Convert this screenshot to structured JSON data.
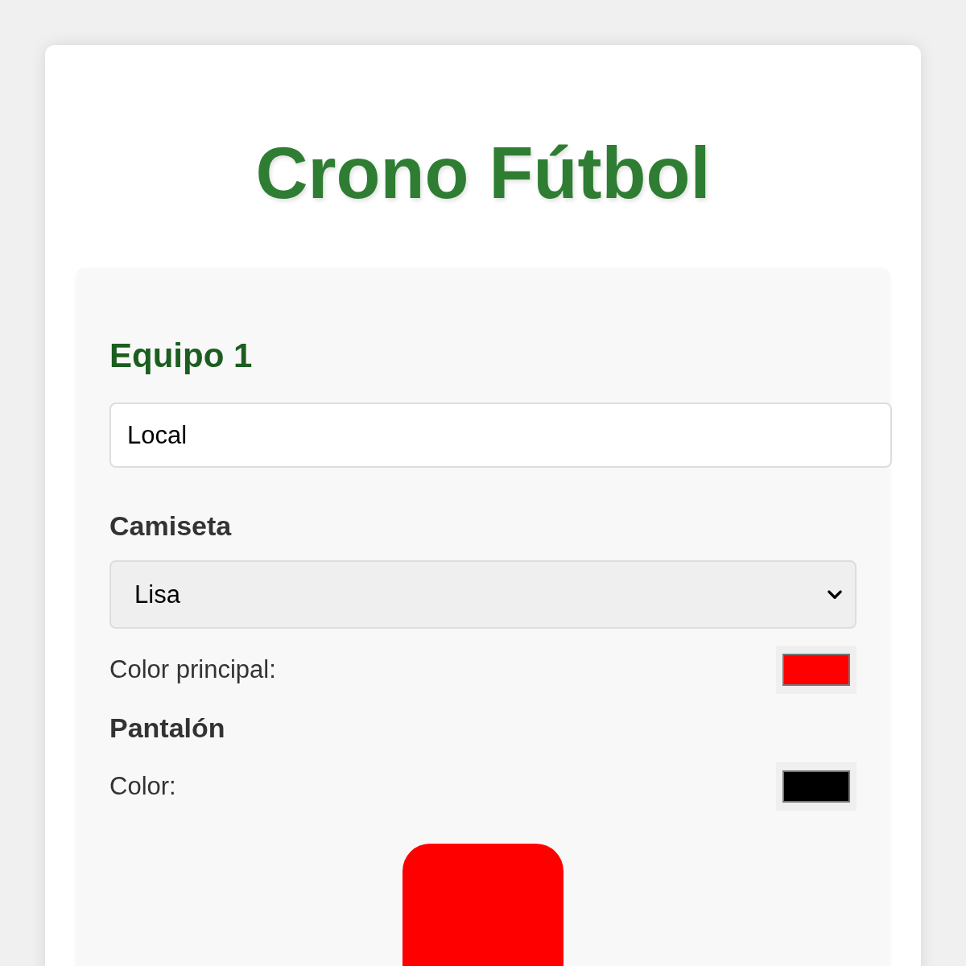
{
  "title": "Crono Fútbol",
  "team": {
    "heading": "Equipo 1",
    "name_field": {
      "value": "Local"
    },
    "shirt": {
      "label": "Camiseta",
      "style_select": {
        "value": "Lisa"
      },
      "colors": [
        {
          "label": "Color principal:",
          "color": "#ff0000"
        }
      ]
    },
    "shorts": {
      "label": "Pantalón",
      "colors": [
        {
          "label": "Color:",
          "color": "#000000"
        }
      ]
    }
  }
}
